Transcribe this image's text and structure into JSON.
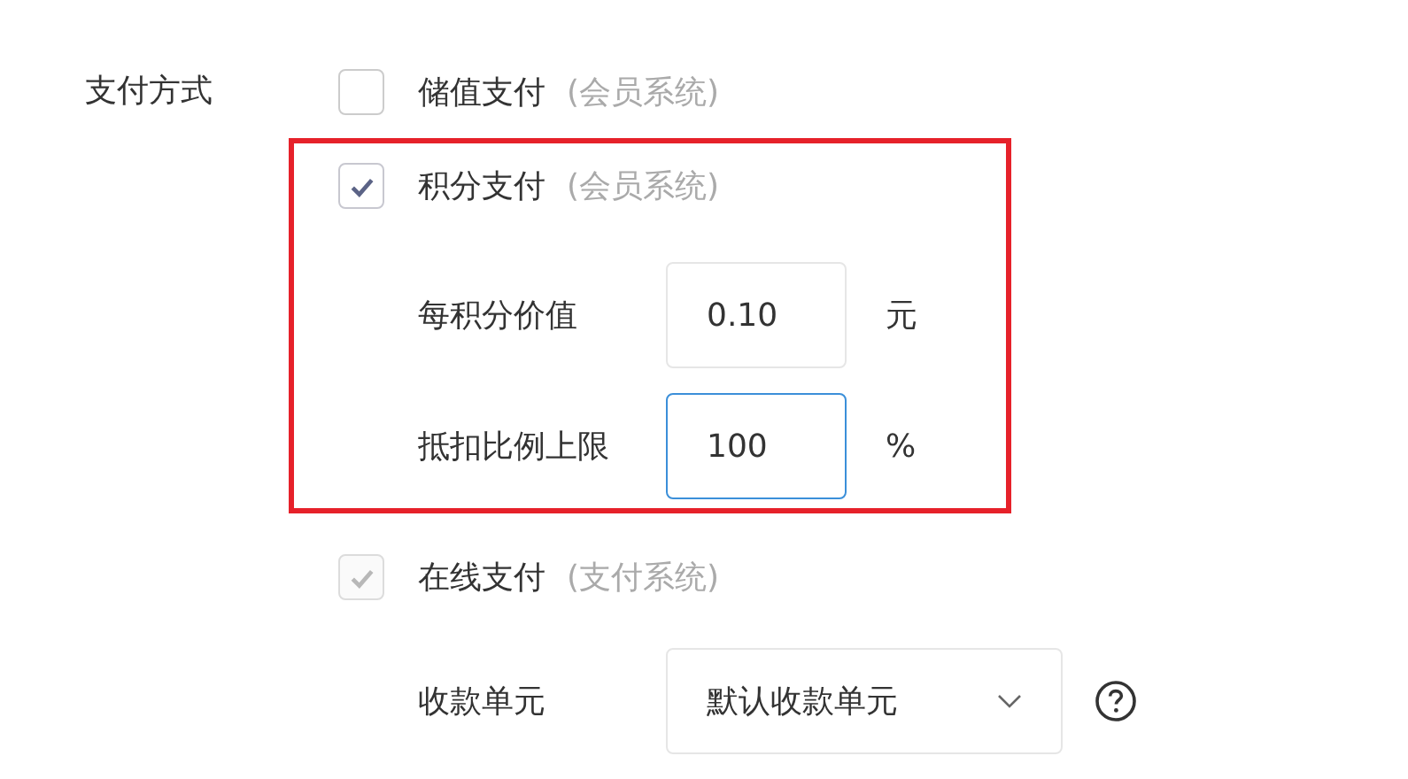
{
  "field_label": "支付方式",
  "options": [
    {
      "label": "储值支付",
      "note": "(会员系统)",
      "checked": false,
      "disabled": false,
      "highlighted": false
    },
    {
      "label": "积分支付",
      "note": "(会员系统)",
      "checked": true,
      "disabled": false,
      "highlighted": true,
      "fields": [
        {
          "kind": "input",
          "label": "每积分价值",
          "value": "0.10",
          "unit": "元",
          "focused": false
        },
        {
          "kind": "input",
          "label": "抵扣比例上限",
          "value": "100",
          "unit": "%",
          "focused": true
        }
      ]
    },
    {
      "label": "在线支付",
      "note": "(支付系统)",
      "checked": true,
      "disabled": true,
      "highlighted": false,
      "fields": [
        {
          "kind": "select",
          "label": "收款单元",
          "value": "默认收款单元",
          "help": true
        }
      ]
    }
  ]
}
